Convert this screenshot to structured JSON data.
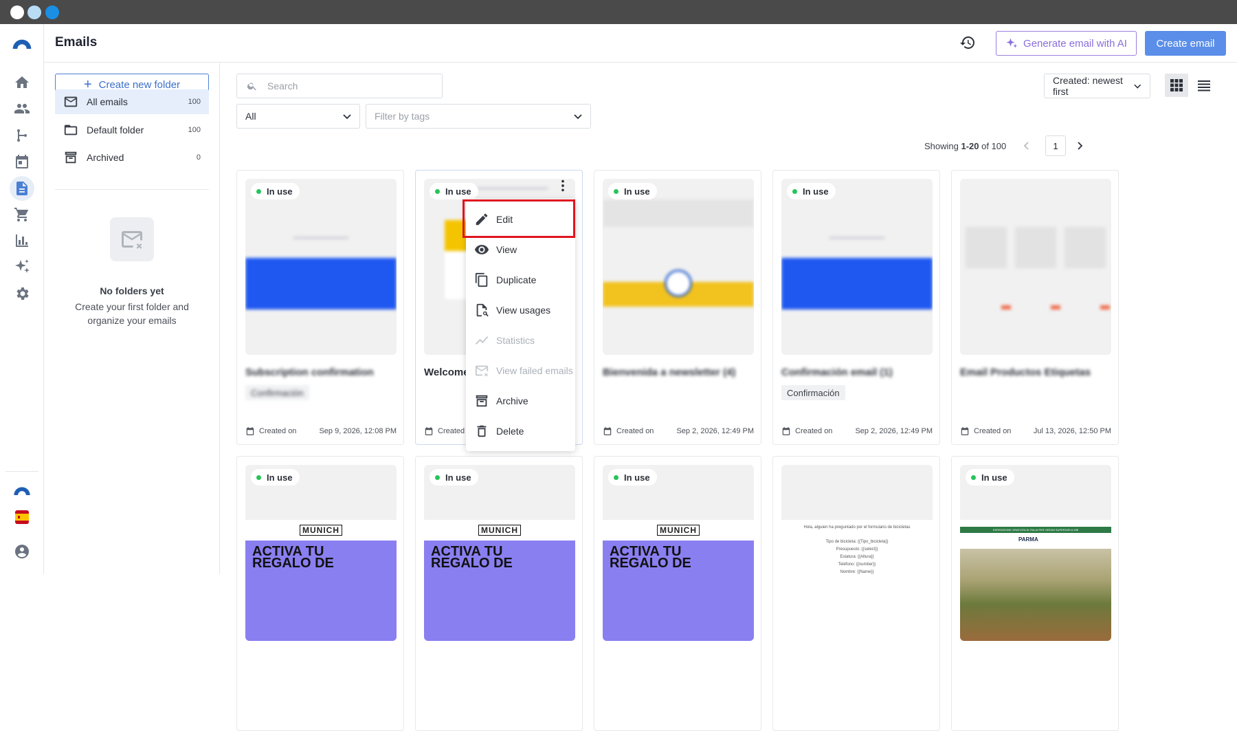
{
  "window": {
    "dots": [
      "#ffffff",
      "#b9dcf5",
      "#1a8fe3"
    ]
  },
  "header": {
    "title": "Emails",
    "ai_button": "Generate email with AI",
    "create_button": "Create email"
  },
  "sidebar_folders": {
    "new_folder": "Create new folder",
    "items": [
      {
        "label": "All emails",
        "count": "100"
      },
      {
        "label": "Default folder",
        "count": "100"
      },
      {
        "label": "Archived",
        "count": "0"
      }
    ],
    "empty_title": "No folders yet",
    "empty_desc": "Create your first folder and organize your emails"
  },
  "filters": {
    "search_placeholder": "Search",
    "type_value": "All",
    "tags_placeholder": "Filter by tags",
    "sort_value": "Created: newest first"
  },
  "pagination": {
    "prefix": "Showing ",
    "range": "1-20",
    "suffix": " of 100",
    "page": "1"
  },
  "cards": [
    {
      "badge": "In use",
      "title": "Subscription confirmation",
      "tag": "Confirmación",
      "created_label": "Created on",
      "date": "Sep 9, 2026, 12:08 PM"
    },
    {
      "badge": "In use",
      "title": "Welcome",
      "tag": "",
      "created_label": "Created on",
      "date": ""
    },
    {
      "badge": "In use",
      "title": "Bienvenida a newsletter (4)",
      "tag": "",
      "created_label": "Created on",
      "date": "Sep 2, 2026, 12:49 PM"
    },
    {
      "badge": "In use",
      "title": "Confirmación email (1)",
      "tag": "Confirmación",
      "created_label": "Created on",
      "date": "Sep 2, 2026, 12:49 PM"
    },
    {
      "badge": "",
      "title": "Email Productos Etiquetas",
      "tag": "",
      "created_label": "Created on",
      "date": "Jul 13, 2026, 12:50 PM"
    }
  ],
  "cards_row2": [
    {
      "badge": "In use",
      "brand": "MUNICH",
      "headline": "ACTIVA TU REGALO DE"
    },
    {
      "badge": "In use",
      "brand": "MUNICH",
      "headline": "ACTIVA TU REGALO DE"
    },
    {
      "badge": "In use",
      "brand": "MUNICH",
      "headline": "ACTIVA TU REGALO DE"
    },
    {
      "badge": "",
      "lines": [
        "Hola, alguien ha preguntado por el formulario de bicicletas",
        "Tipo de bicicleta: {{Tipo_bicicleta}}",
        "Presupuesto: {{select}}",
        "Estatura: {{Altura}}",
        "Teléfono: {{number}}",
        "Nombre: {{Name}}"
      ]
    },
    {
      "badge": "In use",
      "banner": "ESPEDIZIONE GRATUITA IN ITALIA PER ORDINI SUPERIORI A 49€",
      "brand": "PARMA"
    }
  ],
  "context_menu": {
    "items": [
      {
        "label": "Edit",
        "icon": "pencil-icon",
        "disabled": false
      },
      {
        "label": "View",
        "icon": "eye-icon",
        "disabled": false
      },
      {
        "label": "Duplicate",
        "icon": "copy-icon",
        "disabled": false
      },
      {
        "label": "View usages",
        "icon": "file-search-icon",
        "disabled": false
      },
      {
        "label": "Statistics",
        "icon": "chart-line-icon",
        "disabled": true
      },
      {
        "label": "View failed emails",
        "icon": "mail-x-icon",
        "disabled": true
      },
      {
        "label": "Archive",
        "icon": "archive-icon",
        "disabled": false
      },
      {
        "label": "Delete",
        "icon": "trash-icon",
        "disabled": false
      }
    ]
  },
  "colors": {
    "accent": "#5a8ee8",
    "ai": "#8a6ddb",
    "in_use": "#27c45a",
    "highlight": "#e0141e"
  }
}
